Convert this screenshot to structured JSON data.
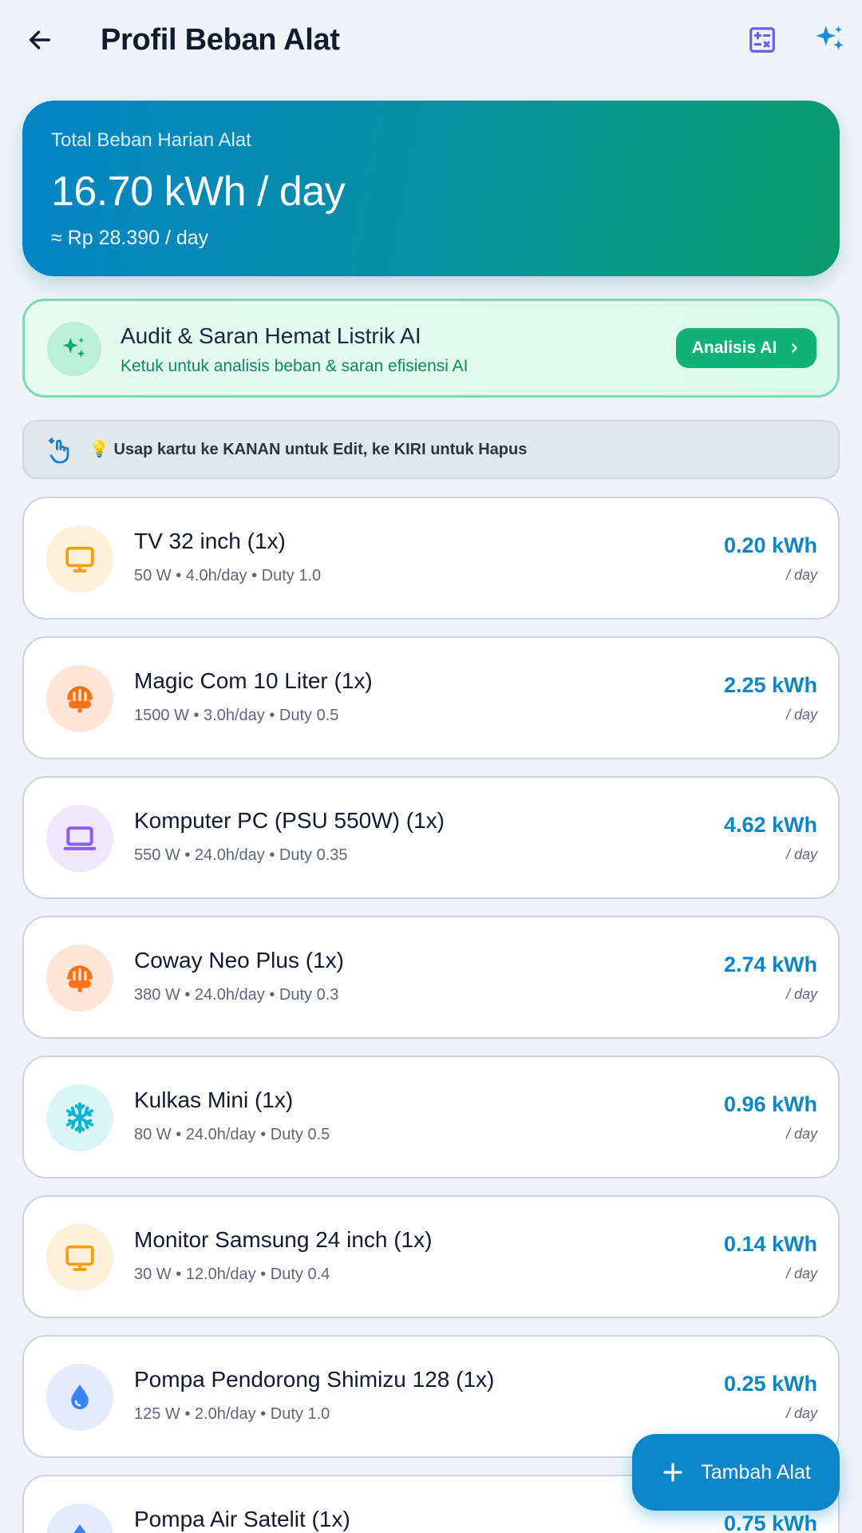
{
  "header": {
    "back_icon": "arrow-left-icon",
    "title": "Profil Beban Alat",
    "calculator_icon": "calculator-icon",
    "sparkle_icon": "sparkles-icon"
  },
  "summary": {
    "label": "Total Beban Harian Alat",
    "value": "16.70 kWh / day",
    "cost": "≈ Rp 28.390 / day"
  },
  "ai_card": {
    "title": "Audit & Saran Hemat Listrik AI",
    "subtitle": "Ketuk untuk analisis beban & saran efisiensi AI",
    "button_label": "Analisis AI",
    "icon": "sparkles-icon"
  },
  "hint": {
    "icon": "swipe-gesture-icon",
    "text": "💡 Usap kartu ke KANAN untuk Edit, ke KIRI untuk Hapus"
  },
  "appliances": [
    {
      "name": "TV 32 inch (1x)",
      "meta": "50 W • 4.0h/day • Duty 1.0",
      "kwh": "0.20 kWh",
      "unit": "/ day",
      "icon": "tv-icon",
      "icon_color": "#f59e0b",
      "icon_bg": "#fdf0da"
    },
    {
      "name": "Magic Com 10 Liter (1x)",
      "meta": "1500 W • 3.0h/day • Duty 0.5",
      "kwh": "2.25 kWh",
      "unit": "/ day",
      "icon": "rice-cooker-icon",
      "icon_color": "#f97316",
      "icon_bg": "#fde6d8"
    },
    {
      "name": "Komputer PC (PSU 550W) (1x)",
      "meta": "550 W • 24.0h/day • Duty 0.35",
      "kwh": "4.62 kWh",
      "unit": "/ day",
      "icon": "laptop-icon",
      "icon_color": "#8b5cf6",
      "icon_bg": "#efe8fd"
    },
    {
      "name": "Coway Neo Plus (1x)",
      "meta": "380 W • 24.0h/day • Duty 0.3",
      "kwh": "2.74 kWh",
      "unit": "/ day",
      "icon": "rice-cooker-icon",
      "icon_color": "#f97316",
      "icon_bg": "#fde6d8"
    },
    {
      "name": "Kulkas Mini (1x)",
      "meta": "80 W • 24.0h/day • Duty 0.5",
      "kwh": "0.96 kWh",
      "unit": "/ day",
      "icon": "snowflake-icon",
      "icon_color": "#06b6d4",
      "icon_bg": "#daf4f8"
    },
    {
      "name": "Monitor Samsung 24 inch (1x)",
      "meta": "30 W • 12.0h/day • Duty 0.4",
      "kwh": "0.14 kWh",
      "unit": "/ day",
      "icon": "tv-icon",
      "icon_color": "#f59e0b",
      "icon_bg": "#fdf0da"
    },
    {
      "name": "Pompa Pendorong Shimizu 128 (1x)",
      "meta": "125 W • 2.0h/day • Duty 1.0",
      "kwh": "0.25 kWh",
      "unit": "/ day",
      "icon": "water-drop-icon",
      "icon_color": "#3b82f6",
      "icon_bg": "#e3ebfd"
    },
    {
      "name": "Pompa Air Satelit (1x)",
      "meta": "",
      "kwh": "0.75 kWh",
      "unit": "",
      "icon": "water-drop-icon",
      "icon_color": "#3b82f6",
      "icon_bg": "#e3ebfd"
    }
  ],
  "fab": {
    "label": "Tambah Alat",
    "icon": "plus-icon"
  },
  "colors": {
    "primary": "#0b86c8",
    "accent_green": "#12b17a",
    "background": "#eff3f8"
  }
}
